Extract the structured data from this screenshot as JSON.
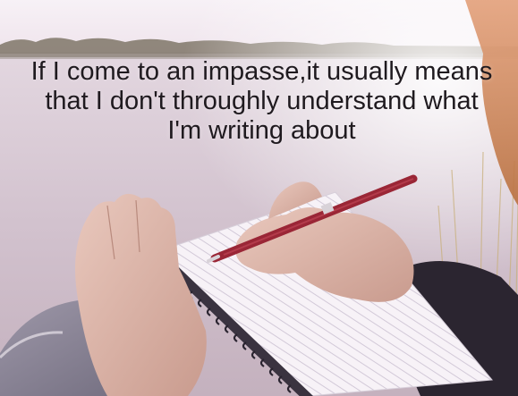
{
  "quote": {
    "text": "If I come to an impasse,it usually means that I don't throughly understand what I'm writing about"
  },
  "colors": {
    "sky": "#f5eef4",
    "water": "#d8c9d4",
    "hair": "#d0885b",
    "pen": "#9a2636",
    "sleeve": "#2b2530",
    "notebook": "#f7f2f7",
    "text": "#1f1a1f"
  },
  "icons": {
    "photo": "woman-writing-in-notebook-by-lake"
  }
}
